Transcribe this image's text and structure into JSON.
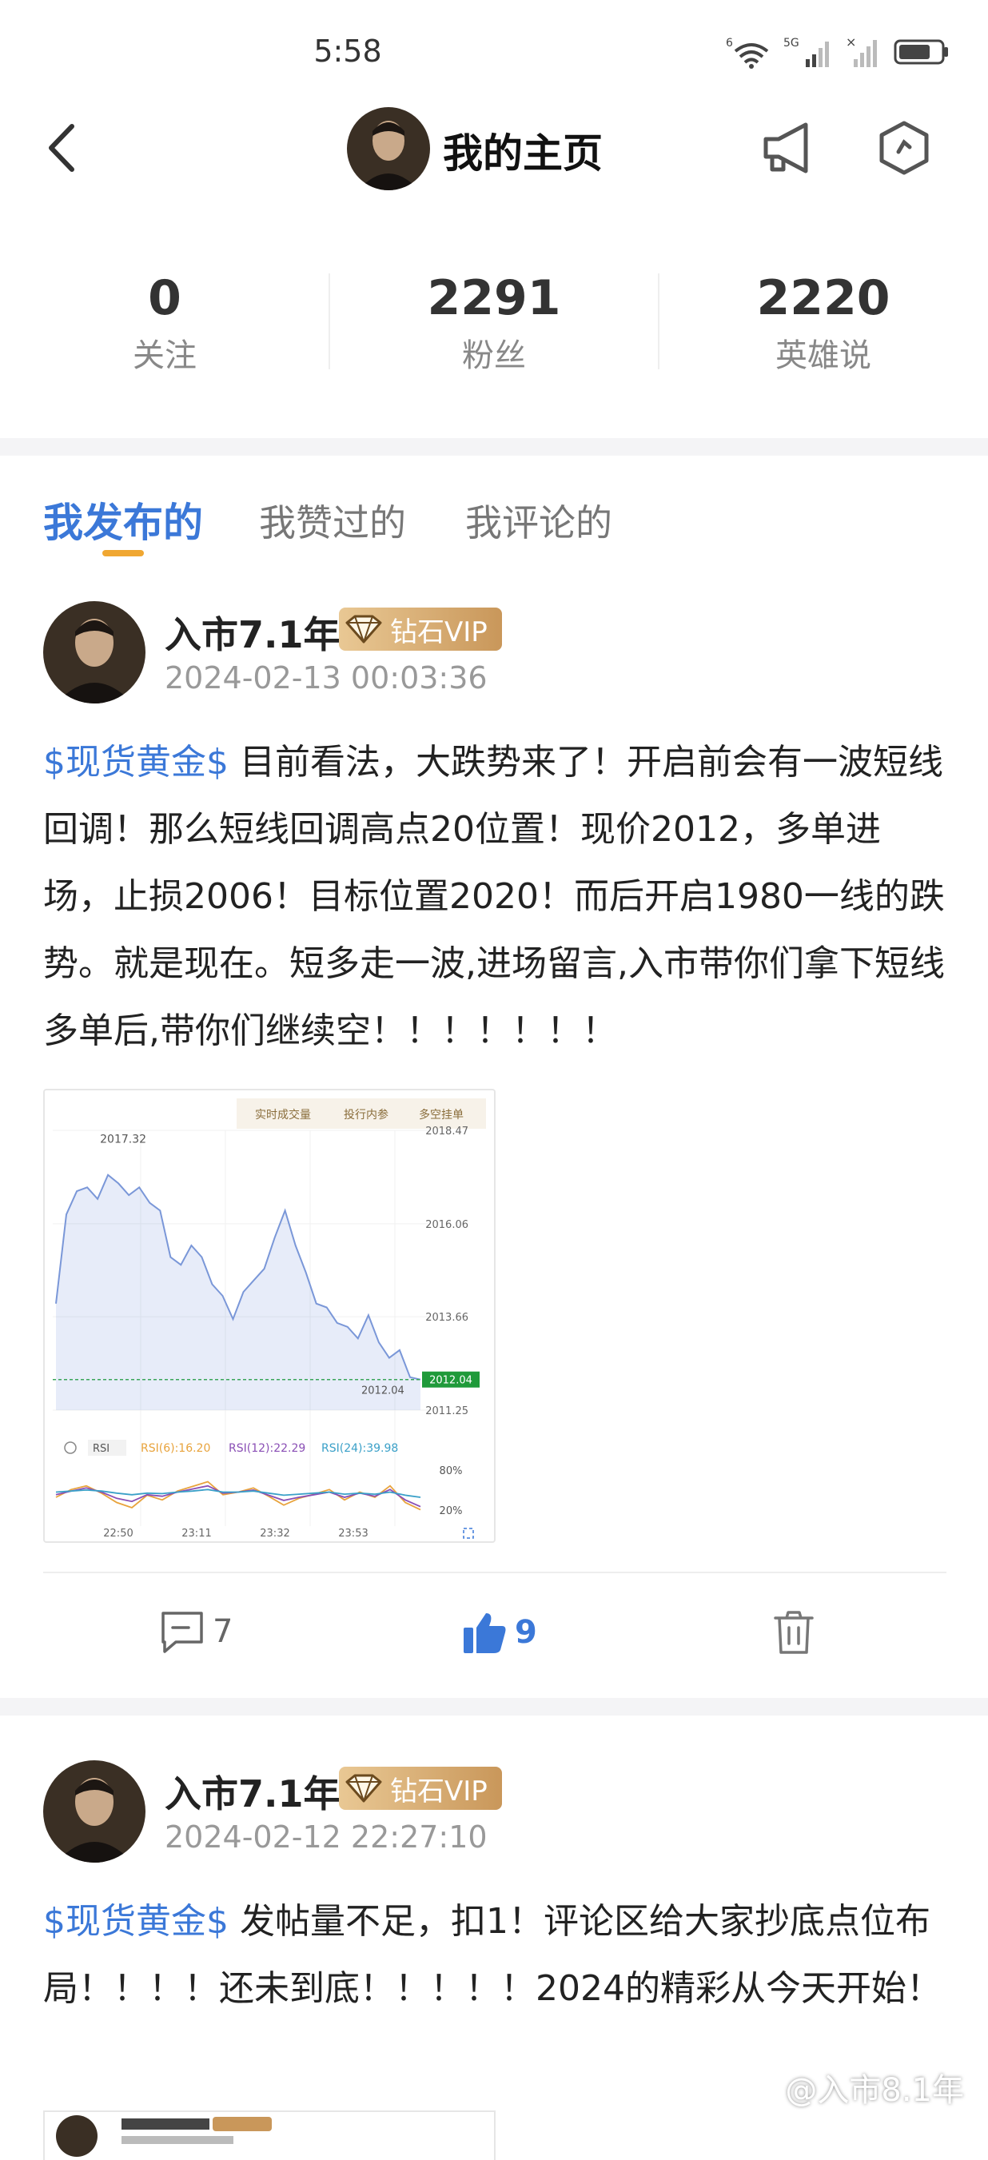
{
  "status_bar": {
    "time": "5:58",
    "network_1": "6",
    "network_2": "5G"
  },
  "header": {
    "title": "我的主页"
  },
  "stats": [
    {
      "value": "0",
      "label": "关注"
    },
    {
      "value": "2291",
      "label": "粉丝"
    },
    {
      "value": "2220",
      "label": "英雄说"
    }
  ],
  "tabs": [
    {
      "label": "我发布的",
      "active": true
    },
    {
      "label": "我赞过的",
      "active": false
    },
    {
      "label": "我评论的",
      "active": false
    }
  ],
  "posts": [
    {
      "author": "入市7.1年",
      "badge": "钻石VIP",
      "time": "2024-02-13 00:03:36",
      "tag": "$现货黄金$",
      "text": " 目前看法，大跌势来了！开启前会有一波短线回调！那么短线回调高点20位置！现价2012，多单进场，止损2006！目标位置2020！而后开启1980一线的跌势。就是现在。短多走一波,进场留言,入市带你们拿下短线多单后,带你们继续空！！！！！！！",
      "comments": "7",
      "likes": "9"
    },
    {
      "author": "入市7.1年",
      "badge": "钻石VIP",
      "time": "2024-02-12 22:27:10",
      "tag": "$现货黄金$",
      "text": " 发帖量不足，扣1！评论区给大家抄底点位布局！！！！还未到底！！！！！2024的精彩从今天开始！"
    }
  ],
  "chart_tabs": [
    "实时成交量",
    "投行内参",
    "多空挂单"
  ],
  "chart_data": {
    "type": "line",
    "x_ticks": [
      "22:50",
      "23:11",
      "23:32",
      "23:53"
    ],
    "y_ticks": [
      "2018.47",
      "2016.06",
      "2013.66",
      "2011.25"
    ],
    "current_price": "2012.04",
    "max_label": "2017.32",
    "last_label": "2012.04",
    "series": [
      {
        "values": [
          2014.0,
          2016.3,
          2016.9,
          2017.0,
          2016.7,
          2017.32,
          2017.1,
          2016.8,
          2017.0,
          2016.6,
          2016.4,
          2015.2,
          2015.0,
          2015.5,
          2015.2,
          2014.5,
          2014.2,
          2013.6,
          2014.3,
          2014.6,
          2014.9,
          2015.7,
          2016.4,
          2015.5,
          2014.8,
          2014.0,
          2013.9,
          2013.5,
          2013.4,
          2013.1,
          2013.7,
          2013.0,
          2012.6,
          2012.8,
          2012.1,
          2012.04
        ]
      }
    ],
    "indicator": {
      "name": "RSI",
      "labels": [
        "RSI(6):16.20",
        "RSI(12):22.29",
        "RSI(24):39.98"
      ],
      "levels": [
        "80%",
        "20%"
      ],
      "series": [
        {
          "name": "RSI(6)",
          "color": "#e8a33c",
          "values": [
            40,
            55,
            62,
            48,
            30,
            20,
            44,
            35,
            52,
            61,
            70,
            45,
            50,
            58,
            42,
            25,
            38,
            46,
            55,
            35,
            50,
            40,
            62,
            30,
            16
          ]
        },
        {
          "name": "RSI(12)",
          "color": "#8a4fb5",
          "values": [
            45,
            52,
            58,
            50,
            38,
            32,
            45,
            42,
            50,
            56,
            62,
            48,
            50,
            54,
            44,
            34,
            40,
            45,
            50,
            40,
            48,
            42,
            55,
            35,
            22
          ]
        },
        {
          "name": "RSI(24)",
          "color": "#3aa0c8",
          "values": [
            50,
            52,
            54,
            52,
            48,
            45,
            48,
            47,
            50,
            52,
            55,
            50,
            50,
            52,
            48,
            44,
            46,
            48,
            50,
            46,
            48,
            46,
            50,
            44,
            40
          ]
        }
      ]
    }
  },
  "watermark": "@入市8.1年",
  "colors": {
    "accent": "#3b78d8",
    "underline": "#f0a732",
    "vip_gold": "#c9975a"
  }
}
